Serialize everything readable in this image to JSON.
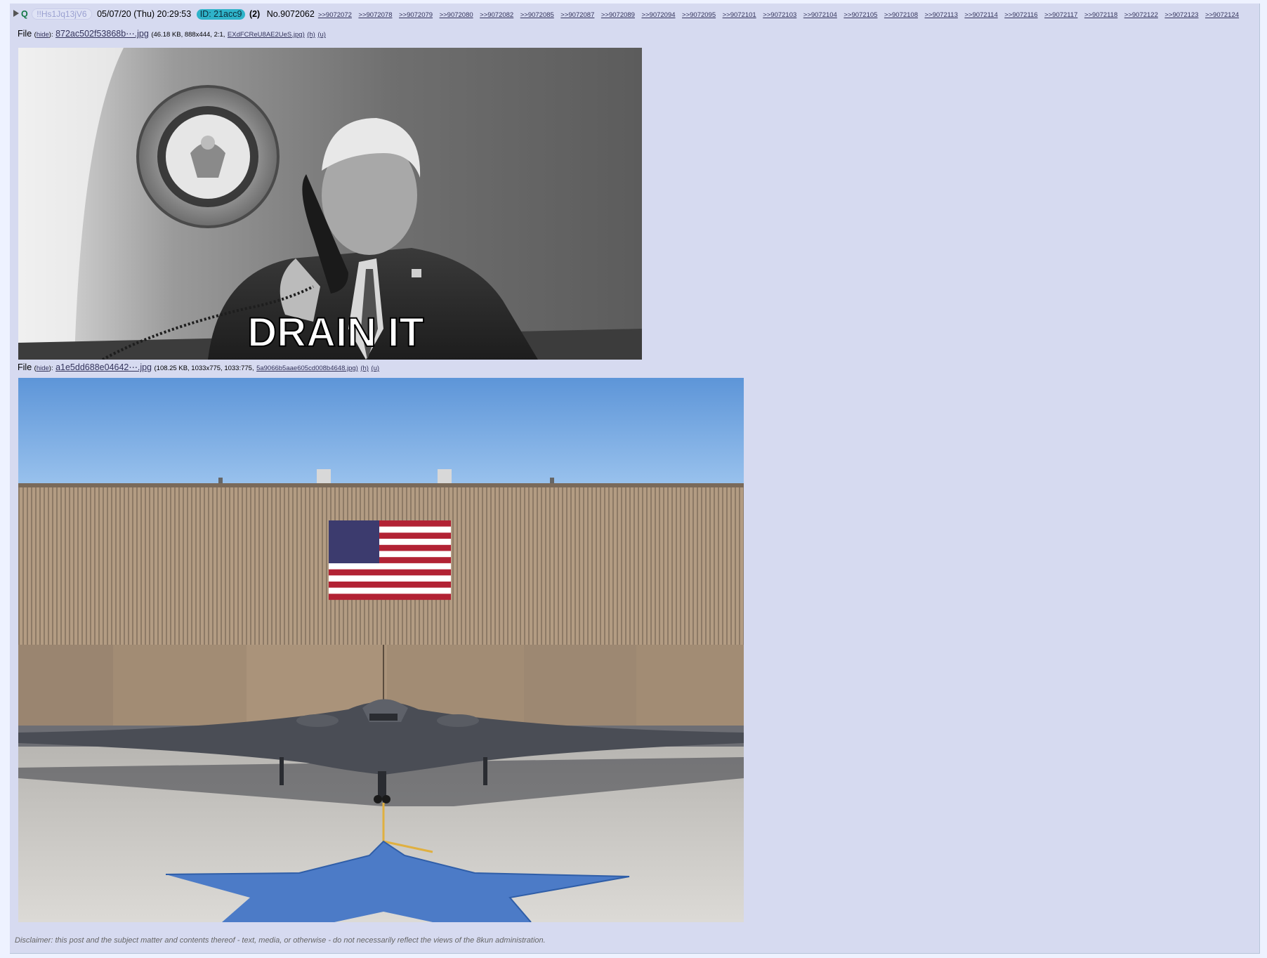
{
  "header": {
    "name": "Q",
    "tripcode": "!!Hs1Jq13jV6",
    "datetime": "05/07/20 (Thu) 20:29:53",
    "poster_id": "ID: 21acc9",
    "post_count": "(2)",
    "post_number": "No.9072062",
    "backlinks": [
      ">>9072072",
      ">>9072078",
      ">>9072079",
      ">>9072080",
      ">>9072082",
      ">>9072085",
      ">>9072087",
      ">>9072089",
      ">>9072094",
      ">>9072095",
      ">>9072101",
      ">>9072103",
      ">>9072104",
      ">>9072105",
      ">>9072108",
      ">>9072113",
      ">>9072114",
      ">>9072116",
      ">>9072117",
      ">>9072118",
      ">>9072122",
      ">>9072123",
      ">>9072124"
    ]
  },
  "files": [
    {
      "label": "File",
      "hide": "hide",
      "filename": "872ac502f53868b⋯.jpg",
      "meta": "(46.18 KB, 888x444, 2:1,",
      "original": "EXdFCReU8AE2UeS.jpg)",
      "h": "(h)",
      "u": "(u)",
      "caption": "DRAIN IT"
    },
    {
      "label": "File",
      "hide": "hide",
      "filename": "a1e5dd688e04642⋯.jpg",
      "meta": "(108.25 KB, 1033x775, 1033:775,",
      "original": "5a9066b5aae605cd008b4648.jpg)",
      "h": "(h)",
      "u": "(u)"
    }
  ],
  "disclaimer": "Disclaimer: this post and the subject matter and contents thereof - text, media, or otherwise - do not necessarily reflect the views of the 8kun administration.",
  "icons": {
    "collapse": "triangle-right-icon"
  }
}
